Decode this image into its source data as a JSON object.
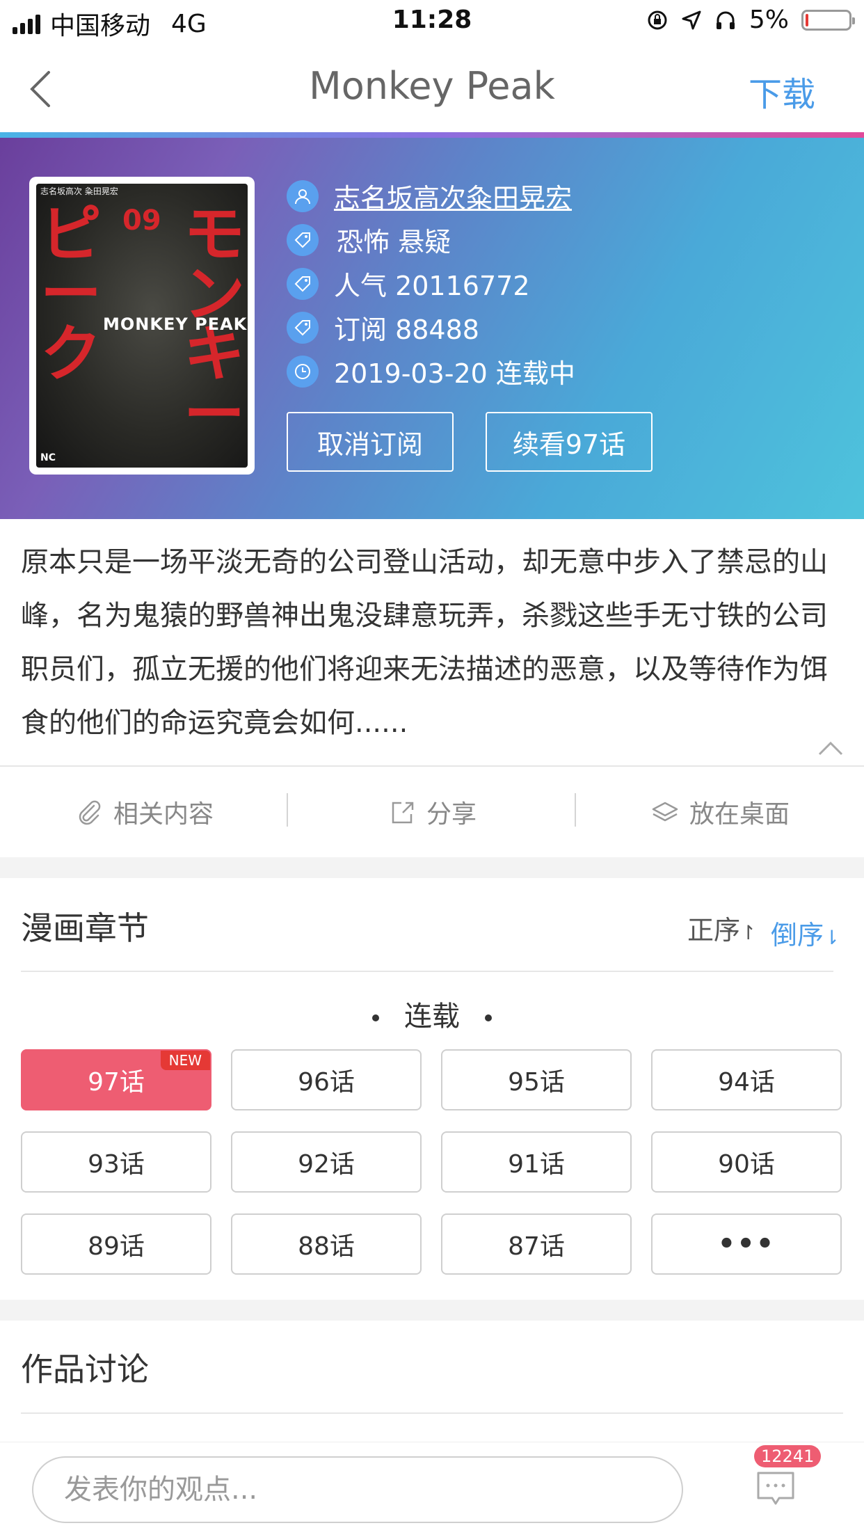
{
  "status_bar": {
    "carrier": "中国移动",
    "network": "4G",
    "time": "11:28",
    "battery": "5%"
  },
  "nav": {
    "title": "Monkey Peak",
    "download_label": "下载"
  },
  "comic": {
    "cover": {
      "katakana": "モンキーピーク",
      "volume": "09",
      "logo_text": "MONKEY PEAK",
      "publisher": "NC",
      "credits": "志名坂高次 粂田晃宏"
    },
    "author1": "志名坂高次",
    "author2": "粂田晃宏",
    "genres": "恐怖 悬疑",
    "popularity": "人气 20116772",
    "subscriptions": "订阅 88488",
    "update_status": "2019-03-20 连载中",
    "unsubscribe_label": "取消订阅",
    "continue_label": "续看97话",
    "description": "原本只是一场平淡无奇的公司登山活动，却无意中步入了禁忌的山峰，名为鬼猿的野兽神出鬼没肆意玩弄，杀戮这些手无寸铁的公司职员们，孤立无援的他们将迎来无法描述的恶意，以及等待作为饵食的他们的命运究竟会如何......"
  },
  "actions": {
    "related": "相关内容",
    "share": "分享",
    "desktop": "放在桌面"
  },
  "chapters": {
    "section_title": "漫画章节",
    "sort_asc": "正序",
    "sort_desc": "倒序",
    "group_label": "连载",
    "new_badge": "NEW",
    "items": [
      "97话",
      "96话",
      "95话",
      "94话",
      "93话",
      "92话",
      "91话",
      "90话",
      "89话",
      "88话",
      "87话",
      "•••"
    ]
  },
  "discussion": {
    "section_title": "作品讨论",
    "comment_placeholder": "发表你的观点...",
    "comment_count": "12241"
  },
  "colors": {
    "accent_blue": "#4a9be8",
    "chapter_active": "#ee5d72",
    "icon_circle": "#5aa0ee"
  }
}
